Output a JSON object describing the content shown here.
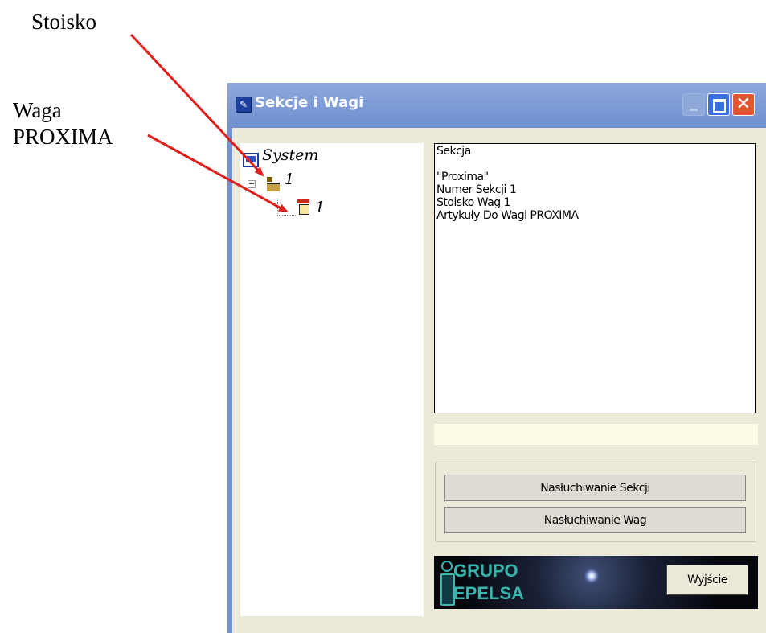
{
  "annotations": {
    "stoisko": "Stoisko",
    "waga_line1": "Waga",
    "waga_line2": "PROXIMA"
  },
  "window": {
    "title": "Sekcje i Wagi",
    "close_glyph": "✕"
  },
  "tree": {
    "root": "System",
    "section": "1",
    "scale": "1"
  },
  "info_panel": {
    "lines": [
      "Sekcja",
      "",
      "\"Proxima\"",
      "Numer Sekcji 1",
      "Stoisko Wag 1",
      "Artykuły Do Wagi PROXIMA"
    ]
  },
  "buttons": {
    "listen_sections": "Nasłuchiwanie Sekcji",
    "listen_scales": "Nasłuchiwanie Wag",
    "exit": "Wyjście"
  },
  "logo": {
    "line1": "GRUPO",
    "line2": "EPELSA"
  },
  "colors": {
    "arrow": "#e0201c",
    "titlebar": "#7b98d6",
    "client": "#ece9d8"
  }
}
